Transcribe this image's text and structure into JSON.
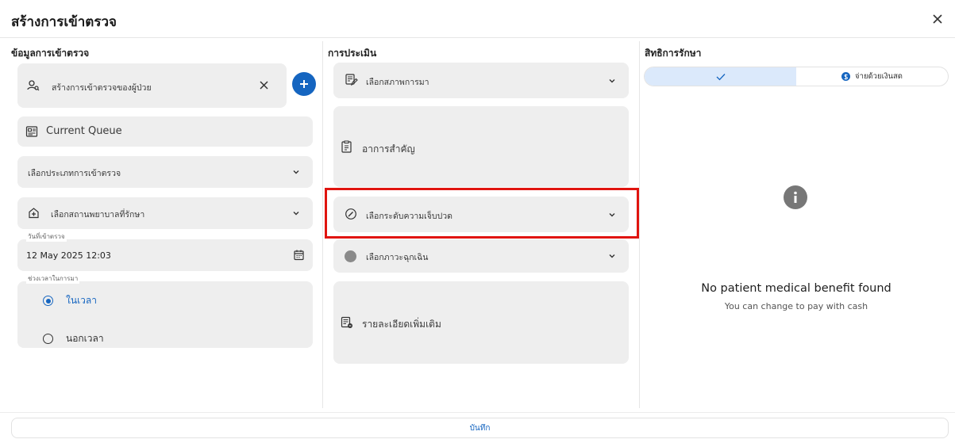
{
  "header": {
    "title": "สร้างการเข้าตรวจ",
    "close_icon": "close-icon"
  },
  "columns": {
    "examination": "ข้อมูลการเข้าตรวจ",
    "assessment": "การประเมิน",
    "rights": "สิทธิการรักษา"
  },
  "left": {
    "patient_visit": {
      "label": "สร้างการเข้าตรวจของผู้ป่วย",
      "icon": "person-search-icon"
    },
    "current_queue": {
      "label": "Current Queue",
      "icon": "queue-card-icon"
    },
    "visit_type": {
      "label": "เลือกประเภทการเข้าตรวจ"
    },
    "hospital": {
      "label": "เลือกสถานพยาบาลที่รักษา",
      "icon": "hospital-icon"
    },
    "visit_date": {
      "caption": "วันที่เข้าตรวจ",
      "value": "12 May 2025 12:03",
      "icon": "calendar-icon"
    },
    "time_period": {
      "caption": "ช่วงเวลาในการมา",
      "options": [
        "ในเวลา",
        "นอกเวลา"
      ],
      "selected": "ในเวลา"
    }
  },
  "middle": {
    "arrival_status": {
      "label": "เลือกสภาพการมา",
      "icon": "clipboard-edit-icon"
    },
    "chief_complaint": {
      "label": "อาการสำคัญ",
      "icon": "clipboard-icon"
    },
    "pain_level": {
      "label": "เลือกระดับความเจ็บปวด",
      "icon": "gauge-icon"
    },
    "emergency": {
      "label": "เลือกภาวะฉุกเฉิน",
      "status_color": "#8a8a8a"
    },
    "details": {
      "label": "รายละเอียดเพิ่มเติม",
      "icon": "notes-icon"
    }
  },
  "right": {
    "payment_toggle": {
      "option_cash": "จ่ายด้วยเงินสด"
    },
    "empty_title": "No patient medical benefit found",
    "empty_sub": "You can change to pay with cash"
  },
  "footer": {
    "save_label": "บันทึก"
  },
  "colors": {
    "accent": "#1565c0",
    "highlight": "#e0140f",
    "field_bg": "#eeeeee"
  }
}
